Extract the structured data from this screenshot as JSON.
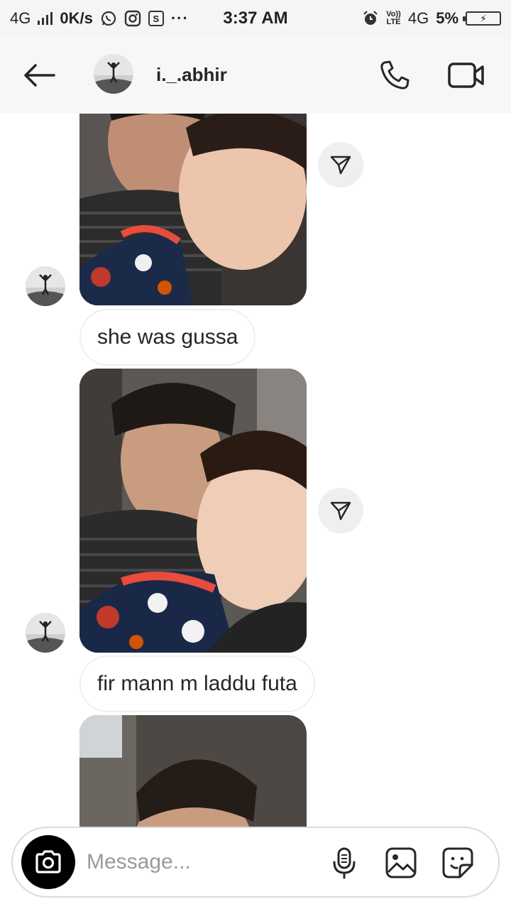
{
  "status_bar": {
    "network": "4G",
    "speed": "0K/s",
    "time": "3:37 AM",
    "volte_top": "Vo))",
    "volte_bottom": "LTE",
    "network_right": "4G",
    "battery": "5%",
    "box_icon_letter": "S",
    "dots": "···"
  },
  "header": {
    "username": "i._.abhir"
  },
  "messages": [
    {
      "type": "photo"
    },
    {
      "type": "text",
      "text": "she was gussa"
    },
    {
      "type": "photo"
    },
    {
      "type": "text",
      "text": "fir mann m laddu futa"
    },
    {
      "type": "photo"
    }
  ],
  "composer": {
    "placeholder": "Message..."
  },
  "icons": {
    "back": "arrow-left-icon",
    "call": "phone-icon",
    "video": "video-camera-icon",
    "share": "paper-plane-icon",
    "camera": "camera-icon",
    "mic": "microphone-icon",
    "gallery": "image-icon",
    "sticker": "sticker-icon"
  },
  "colors": {
    "background": "#ffffff",
    "header": "#f7f7f7",
    "bubble_border": "#efefef",
    "text": "#262626",
    "placeholder": "#9a9a9a"
  }
}
